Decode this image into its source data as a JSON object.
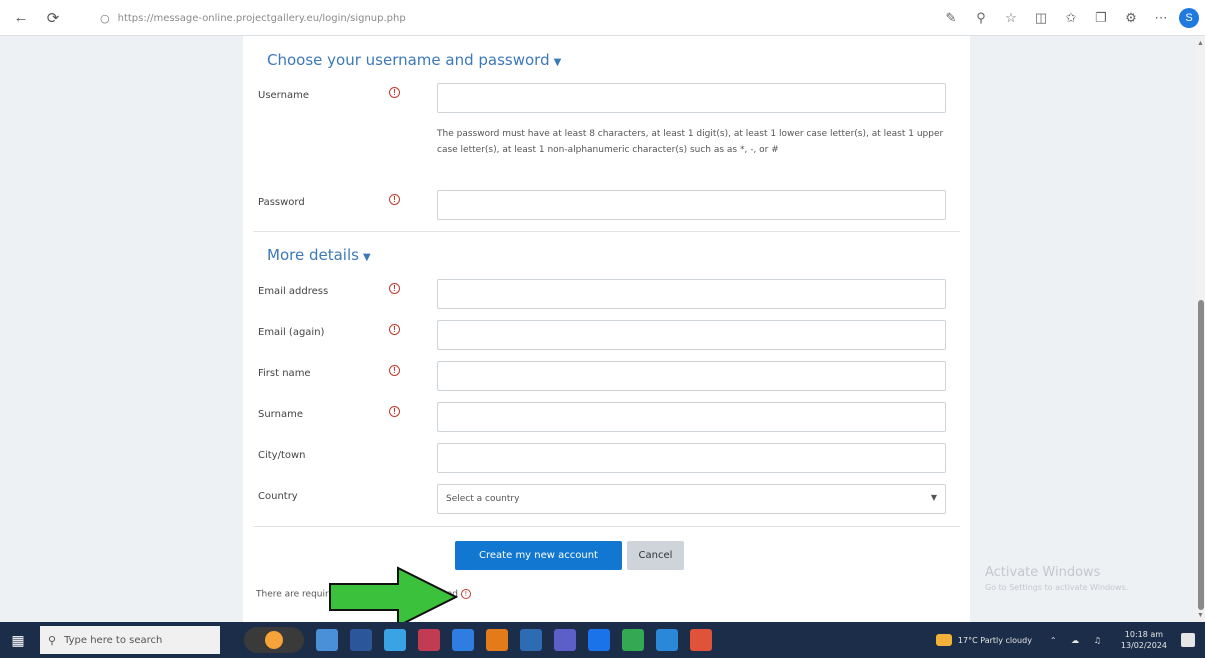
{
  "browser": {
    "url": "https://message-online.projectgallery.eu/login/signup.php",
    "back": "←",
    "refresh": "⟳",
    "lock": "🔒",
    "profile_initial": "S"
  },
  "section1": {
    "title": "Choose your username and password"
  },
  "section2": {
    "title": "More details"
  },
  "fields": {
    "username_label": "Username",
    "password_help": "The password must have at least 8 characters, at least 1 digit(s), at least 1 lower case letter(s), at least 1 upper case letter(s), at least 1 non-alphanumeric character(s) such as as *, -, or #",
    "password_label": "Password",
    "email_label": "Email address",
    "email_again_label": "Email (again)",
    "firstname_label": "First name",
    "surname_label": "Surname",
    "city_label": "City/town",
    "country_label": "Country",
    "country_value": "Select a country"
  },
  "buttons": {
    "create": "Create my new account",
    "cancel": "Cancel"
  },
  "footnote": "There are required fields in this form marked",
  "required_mark": "!",
  "watermark": {
    "line1": "Activate Windows",
    "line2": "Go to Settings to activate Windows."
  },
  "taskbar": {
    "search_placeholder": "Type here to search",
    "weather": "17°C Partly cloudy",
    "time": "10:18 am",
    "date": "13/02/2024"
  },
  "colors": {
    "accent": "#1177d1",
    "link": "#3c79b9",
    "arrow": "#3cc13c",
    "taskbar": "#1c2d4a"
  }
}
